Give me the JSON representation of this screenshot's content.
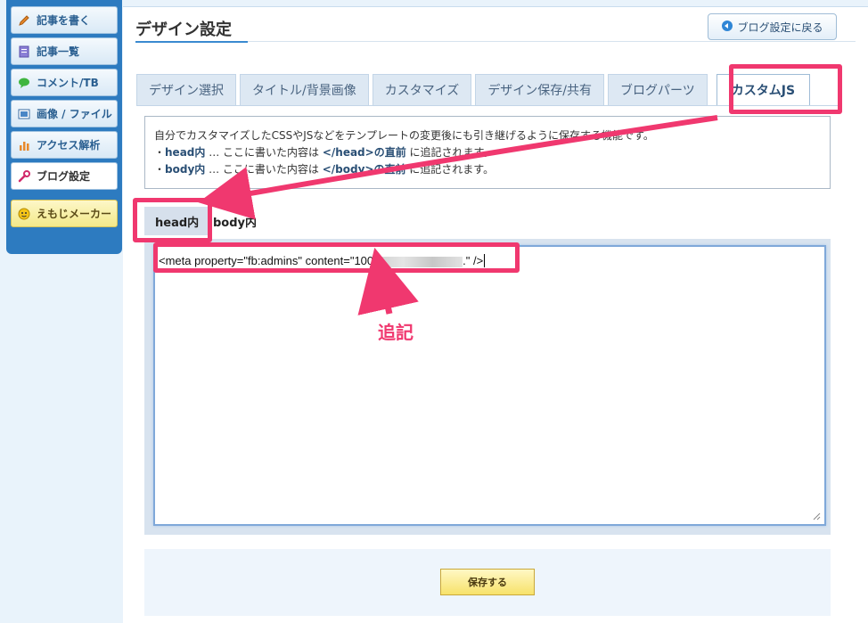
{
  "sidebar": {
    "items": [
      {
        "label": "記事を書く",
        "icon": "pencil-icon",
        "active": false
      },
      {
        "label": "記事一覧",
        "icon": "document-icon",
        "active": false
      },
      {
        "label": "コメント/TB",
        "icon": "speech-bubble-icon",
        "active": false
      },
      {
        "label": "画像 / ファイル",
        "icon": "image-icon",
        "active": false
      },
      {
        "label": "アクセス解析",
        "icon": "bar-chart-icon",
        "active": false
      },
      {
        "label": "ブログ設定",
        "icon": "wrench-icon",
        "active": true
      }
    ],
    "emoji_maker": "えもじメーカー"
  },
  "header": {
    "title": "デザイン設定",
    "back_button": "ブログ設定に戻る"
  },
  "tabs": [
    {
      "label": "デザイン選択",
      "active": false
    },
    {
      "label": "タイトル/背景画像",
      "active": false
    },
    {
      "label": "カスタマイズ",
      "active": false
    },
    {
      "label": "デザイン保存/共有",
      "active": false
    },
    {
      "label": "ブログパーツ",
      "active": false
    },
    {
      "label": "カスタムJS",
      "active": true
    }
  ],
  "description": {
    "intro": "自分でカスタマイズしたCSSやJSなどをテンプレートの変更後にも引き継げるように保存する機能です。",
    "head_prefix": "・",
    "head_term": "head内",
    "head_mid": " … ここに書いた内容は ",
    "head_target": "</head>の直前",
    "head_suffix": " に追記されます。",
    "body_prefix": "・",
    "body_term": "body内",
    "body_mid": " … ここに書いた内容は ",
    "body_target": "</body>の直前",
    "body_suffix": " に追記されます。"
  },
  "subtabs": {
    "head": "head内",
    "body": "body内"
  },
  "editor": {
    "value_before": "<meta property=\"fb:admins\" content=\"100",
    "value_after": ".\" />"
  },
  "save_button": "保存する",
  "annotation": {
    "label": "追記"
  },
  "colors": {
    "accent": "#f0386f",
    "sidebar": "#2d7bc0",
    "save_button": "#f7e26a"
  }
}
